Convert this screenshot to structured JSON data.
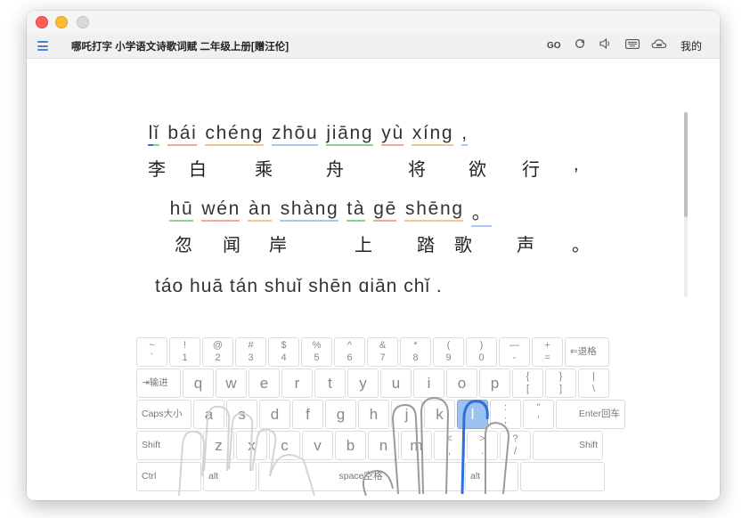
{
  "window": {
    "title": "哪吒打字 小学语文诗歌词赋 二年级上册[赠汪伦]"
  },
  "toolbar": {
    "go_label": "GO",
    "refresh_icon": "↻",
    "sound_icon": "🔈",
    "keyboard_icon": "⌨",
    "cloud_icon": "☁",
    "mine_label": "我的"
  },
  "poem": {
    "line1": {
      "pinyin": [
        {
          "text": "lǐ",
          "chars": [
            {
              "c": "l",
              "u": "first"
            },
            {
              "c": "ǐ",
              "u": "green"
            }
          ]
        },
        {
          "text": "bái",
          "chars": [
            {
              "c": "b",
              "u": "red"
            },
            {
              "c": "á",
              "u": "red"
            },
            {
              "c": "i",
              "u": "red"
            }
          ]
        },
        {
          "text": "chéng",
          "chars": [
            {
              "c": "c",
              "u": "orange"
            },
            {
              "c": "h",
              "u": "orange"
            },
            {
              "c": "é",
              "u": "orange"
            },
            {
              "c": "n",
              "u": "orange"
            },
            {
              "c": "g",
              "u": "orange"
            }
          ]
        },
        {
          "text": "zhōu",
          "chars": [
            {
              "c": "z",
              "u": "lblue"
            },
            {
              "c": "h",
              "u": "lblue"
            },
            {
              "c": "ō",
              "u": "lblue"
            },
            {
              "c": "u",
              "u": "lblue"
            }
          ]
        },
        {
          "text": "jiāng",
          "chars": [
            {
              "c": "j",
              "u": "green"
            },
            {
              "c": "i",
              "u": "green"
            },
            {
              "c": "ā",
              "u": "green"
            },
            {
              "c": "n",
              "u": "green"
            },
            {
              "c": "g",
              "u": "green"
            }
          ]
        },
        {
          "text": "yù",
          "chars": [
            {
              "c": "y",
              "u": "red"
            },
            {
              "c": "ù",
              "u": "red"
            }
          ]
        },
        {
          "text": "xíng",
          "chars": [
            {
              "c": "x",
              "u": "orange"
            },
            {
              "c": "í",
              "u": "orange"
            },
            {
              "c": "n",
              "u": "orange"
            },
            {
              "c": "g",
              "u": "orange"
            }
          ]
        },
        {
          "text": ",",
          "chars": [
            {
              "c": ",",
              "u": "lblue"
            }
          ]
        }
      ],
      "hanzi": [
        "李",
        "白",
        "乘",
        "舟",
        "将",
        "欲",
        "行",
        ","
      ]
    },
    "line2": {
      "pinyin": [
        {
          "text": "hū",
          "chars": [
            {
              "c": "h",
              "u": "green"
            },
            {
              "c": "ū",
              "u": "green"
            }
          ]
        },
        {
          "text": "wén",
          "chars": [
            {
              "c": "w",
              "u": "red"
            },
            {
              "c": "é",
              "u": "red"
            },
            {
              "c": "n",
              "u": "red"
            }
          ]
        },
        {
          "text": "àn",
          "chars": [
            {
              "c": "à",
              "u": "orange"
            },
            {
              "c": "n",
              "u": "orange"
            }
          ]
        },
        {
          "text": "shàng",
          "chars": [
            {
              "c": "s",
              "u": "lblue"
            },
            {
              "c": "h",
              "u": "lblue"
            },
            {
              "c": "à",
              "u": "lblue"
            },
            {
              "c": "n",
              "u": "lblue"
            },
            {
              "c": "g",
              "u": "lblue"
            }
          ]
        },
        {
          "text": "tà",
          "chars": [
            {
              "c": "t",
              "u": "green"
            },
            {
              "c": "à",
              "u": "green"
            }
          ]
        },
        {
          "text": "gē",
          "chars": [
            {
              "c": "g",
              "u": "red"
            },
            {
              "c": "ē",
              "u": "red"
            }
          ]
        },
        {
          "text": "shēng",
          "chars": [
            {
              "c": "s",
              "u": "orange"
            },
            {
              "c": "h",
              "u": "orange"
            },
            {
              "c": "ē",
              "u": "orange"
            },
            {
              "c": "n",
              "u": "orange"
            },
            {
              "c": "g",
              "u": "orange"
            }
          ]
        },
        {
          "text": "。",
          "chars": [
            {
              "c": "。",
              "u": "lblue"
            }
          ]
        }
      ],
      "hanzi": [
        "忽",
        "闻",
        "岸",
        "上",
        "踏",
        "歌",
        "声",
        "。"
      ]
    },
    "line3_partial": "táo huā tán shuǐ shēn qiān chǐ ,"
  },
  "keyboard": {
    "row_num": [
      {
        "top": "~",
        "bottom": "`"
      },
      {
        "top": "!",
        "bottom": "1"
      },
      {
        "top": "@",
        "bottom": "2"
      },
      {
        "top": "#",
        "bottom": "3"
      },
      {
        "top": "$",
        "bottom": "4"
      },
      {
        "top": "%",
        "bottom": "5"
      },
      {
        "top": "^",
        "bottom": "6"
      },
      {
        "top": "&",
        "bottom": "7"
      },
      {
        "top": "*",
        "bottom": "8"
      },
      {
        "top": "(",
        "bottom": "9"
      },
      {
        "top": ")",
        "bottom": "0"
      },
      {
        "top": "—",
        "bottom": "-"
      },
      {
        "top": "+",
        "bottom": "="
      }
    ],
    "backspace": "⇐退格",
    "tab": "⇥输进",
    "row_q": [
      "q",
      "w",
      "e",
      "r",
      "t",
      "y",
      "u",
      "i",
      "o",
      "p"
    ],
    "bracket_l": {
      "top": "{",
      "bottom": "["
    },
    "bracket_r": {
      "top": "}",
      "bottom": "]"
    },
    "backslash": {
      "top": "|",
      "bottom": "\\"
    },
    "caps": "Caps大小写",
    "row_a": [
      "a",
      "s",
      "d",
      "f",
      "g",
      "h",
      "j",
      "k",
      "l"
    ],
    "semicolon": {
      "top": ":",
      "bottom": ";"
    },
    "quote": {
      "top": "\"",
      "bottom": "'"
    },
    "enter": "Enter回车",
    "shift_l": "Shift",
    "row_z": [
      "z",
      "x",
      "c",
      "v",
      "b",
      "n",
      "m"
    ],
    "comma": {
      "top": "<",
      "bottom": ","
    },
    "period": {
      "top": ">",
      "bottom": "."
    },
    "slash": {
      "top": "?",
      "bottom": "/"
    },
    "shift_r": "Shift",
    "ctrl": "Ctrl",
    "alt_l": "alt",
    "space": "space空格",
    "alt_r": "alt",
    "highlighted_key": "l"
  },
  "colors": {
    "accent": "#4a7fd8",
    "highlight_key": "#9cc3ef",
    "guide_finger": "#2f6fd8"
  }
}
